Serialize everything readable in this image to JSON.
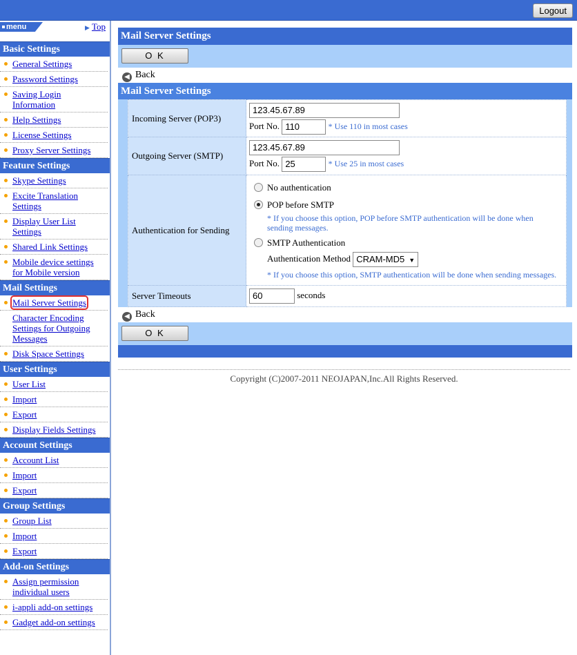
{
  "header": {
    "logout_label": "Logout"
  },
  "sidebar": {
    "menu_label": "menu",
    "top_link": "Top",
    "sections": [
      {
        "title": "Basic Settings",
        "items": [
          "General Settings",
          "Password Settings",
          "Saving Login Information",
          "Help Settings",
          "License Settings",
          "Proxy Server Settings"
        ]
      },
      {
        "title": "Feature Settings",
        "items": [
          "Skype Settings",
          "Excite Translation Settings",
          "Display User List Settings",
          "Shared Link Settings",
          "Mobile device settings for Mobile version"
        ]
      },
      {
        "title": "Mail Settings",
        "items": [
          "Mail Server Settings",
          "Character Encoding Settings for Outgoing Messages",
          "Disk Space Settings"
        ]
      },
      {
        "title": "User Settings",
        "items": [
          "User List",
          "Import",
          "Export",
          "Display Fields Settings"
        ]
      },
      {
        "title": "Account Settings",
        "items": [
          "Account List",
          "Import",
          "Export"
        ]
      },
      {
        "title": "Group Settings",
        "items": [
          "Group List",
          "Import",
          "Export"
        ]
      },
      {
        "title": "Add-on Settings",
        "items": [
          "Assign permission individual users",
          "i-appli add-on settings",
          "Gadget add-on settings"
        ]
      }
    ]
  },
  "main": {
    "title": "Mail Server Settings",
    "ok_label": "O K",
    "back_label": "Back",
    "form_title": "Mail Server Settings",
    "incoming": {
      "label": "Incoming Server (POP3)",
      "server": "123.45.67.89",
      "port_label": "Port No.",
      "port": "110",
      "hint": "* Use 110 in most cases"
    },
    "outgoing": {
      "label": "Outgoing Server (SMTP)",
      "server": "123.45.67.89",
      "port_label": "Port No.",
      "port": "25",
      "hint": "* Use 25 in most cases"
    },
    "auth": {
      "label": "Authentication for Sending",
      "opt_none": "No authentication",
      "opt_pop": "POP before SMTP",
      "pop_hint": "* If you choose this option, POP before SMTP authentication will be done when sending messages.",
      "opt_smtp": "SMTP Authentication",
      "method_label": "Authentication Method",
      "method_value": "CRAM-MD5",
      "smtp_hint": "* If you choose this option, SMTP authentication will be done when sending messages.",
      "selected": "POP before SMTP"
    },
    "timeout": {
      "label": "Server Timeouts",
      "value": "60",
      "unit": "seconds"
    }
  },
  "footer": {
    "copyright": "Copyright (C)2007-2011 NEOJAPAN,Inc.All Rights Reserved."
  }
}
